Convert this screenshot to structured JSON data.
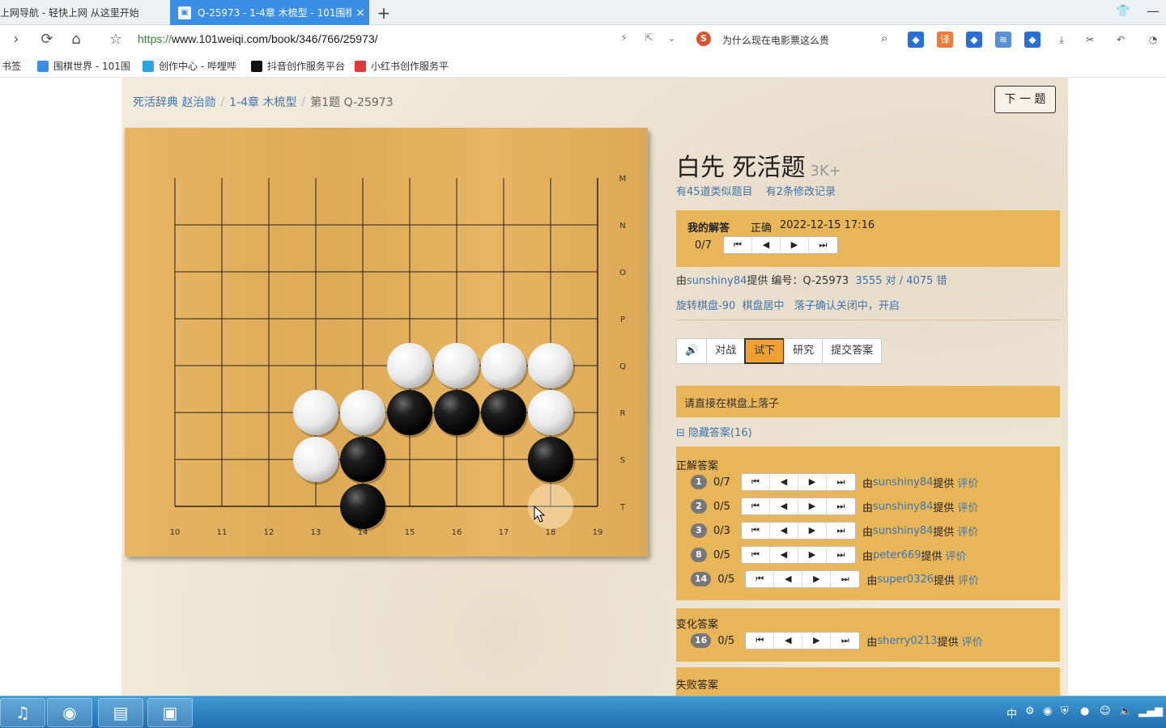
{
  "browser": {
    "tabs": [
      {
        "title": "上网导航 - 轻快上网 从这里开始",
        "active": false
      },
      {
        "title": "Q-25973 - 1-4章 木梳型 - 101围棋",
        "active": true
      }
    ],
    "url_scheme": "https://",
    "url_rest": "www.101weiqi.com/book/346/766/25973/",
    "search_text": "为什么现在电影票这么贵",
    "bookmarks_label": "书签",
    "bookmarks": [
      {
        "label": "围棋世界 - 101围",
        "icon_color": "#3a8ee6"
      },
      {
        "label": "创作中心 - 哔哩哔",
        "icon_color": "#2aa6df"
      },
      {
        "label": "抖音创作服务平台",
        "icon_color": "#111111"
      },
      {
        "label": "小红书创作服务平",
        "icon_color": "#e03a3a"
      }
    ]
  },
  "page": {
    "breadcrumb": [
      {
        "label": "死活辞典 赵治勋",
        "link": true
      },
      {
        "label": "1-4章 木梳型",
        "link": true
      },
      {
        "label": "第1题 Q-25973",
        "link": false
      }
    ],
    "next_button": "下 一 题",
    "title": "白先 死活题",
    "level": "3K+",
    "similar_link": "有45道类似题目",
    "history_link": "有2条修改记录",
    "my_answer": {
      "label": "我的解答",
      "status": "正确",
      "date": "2022-12-15 17:16",
      "progress": "0/7"
    },
    "info": {
      "prefix": "由",
      "provider": "sunshiny84",
      "provided": "提供 编号：Q-25973",
      "stats": "3555 对 / 4075 错",
      "rotate": "旋转棋盘-90",
      "center": "棋盘居中",
      "confirm": "落子确认关闭中，开启"
    },
    "modes": [
      {
        "label": "🔊",
        "active": false,
        "name": "mode-sound-button"
      },
      {
        "label": "对战",
        "active": false,
        "name": "mode-battle-button"
      },
      {
        "label": "试下",
        "active": true,
        "name": "mode-try-button"
      },
      {
        "label": "研究",
        "active": false,
        "name": "mode-research-button"
      },
      {
        "label": "提交答案",
        "active": false,
        "name": "mode-submit-button"
      }
    ],
    "prompt": "请直接在棋盘上落子",
    "hide_answers": "⊟ 隐藏答案(16)",
    "correct_heading": "正解答案",
    "correct_answers": [
      {
        "num": "1",
        "progress": "0/7",
        "user": "sunshiny84"
      },
      {
        "num": "2",
        "progress": "0/5",
        "user": "sunshiny84"
      },
      {
        "num": "3",
        "progress": "0/3",
        "user": "sunshiny84"
      },
      {
        "num": "8",
        "progress": "0/5",
        "user": "peter669"
      },
      {
        "num": "14",
        "progress": "0/5",
        "user": "super0326"
      }
    ],
    "variation_heading": "变化答案",
    "variation_answers": [
      {
        "num": "16",
        "progress": "0/5",
        "user": "sherry0213"
      }
    ],
    "fail_heading": "失败答案",
    "by_prefix": "由",
    "by_suffix": "提供",
    "rate_label": "评价"
  },
  "board": {
    "col_labels": [
      "10",
      "11",
      "12",
      "13",
      "14",
      "15",
      "16",
      "17",
      "18",
      "19"
    ],
    "row_labels": [
      "M",
      "N",
      "O",
      "P",
      "Q",
      "R",
      "S",
      "T"
    ],
    "stones": [
      {
        "color": "white",
        "col": 15,
        "row": "Q"
      },
      {
        "color": "white",
        "col": 16,
        "row": "Q"
      },
      {
        "color": "white",
        "col": 17,
        "row": "Q"
      },
      {
        "color": "white",
        "col": 18,
        "row": "Q"
      },
      {
        "color": "white",
        "col": 13,
        "row": "R"
      },
      {
        "color": "white",
        "col": 14,
        "row": "R"
      },
      {
        "color": "black",
        "col": 15,
        "row": "R"
      },
      {
        "color": "black",
        "col": 16,
        "row": "R"
      },
      {
        "color": "black",
        "col": 17,
        "row": "R"
      },
      {
        "color": "white",
        "col": 18,
        "row": "R"
      },
      {
        "color": "white",
        "col": 13,
        "row": "S"
      },
      {
        "color": "black",
        "col": 14,
        "row": "S"
      },
      {
        "color": "black",
        "col": 18,
        "row": "S"
      },
      {
        "color": "black",
        "col": 14,
        "row": "T"
      }
    ],
    "hover": {
      "col": 18,
      "row": "T"
    }
  },
  "colors": {
    "board": "#e5b05a",
    "panel": "#e8b659",
    "link": "#3c75b0",
    "active_tab": "#3a8ee6",
    "active_mode": "#f0a030"
  },
  "taskbar": {
    "apps": [
      "music-app",
      "browser-app",
      "file-explorer-app",
      "presentation-app"
    ]
  }
}
